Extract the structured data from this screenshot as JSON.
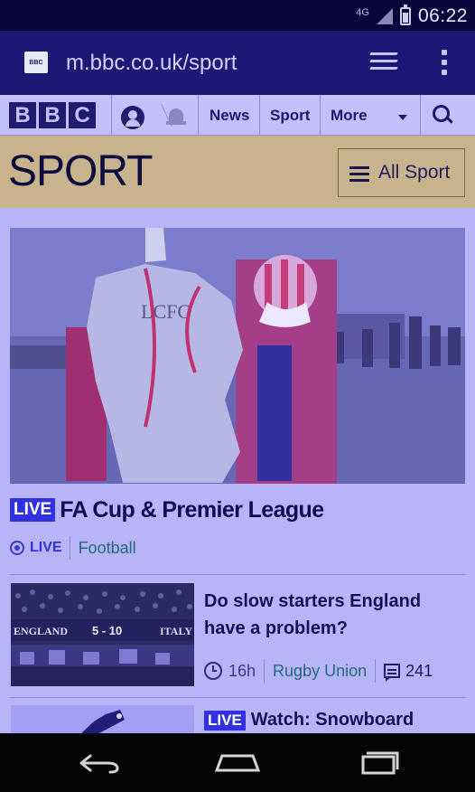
{
  "status_bar": {
    "network": "4G",
    "time": "06:22"
  },
  "browser": {
    "favicon_text": "BBC",
    "url": "m.bbc.co.uk/sport",
    "icons": [
      "tabs-icon",
      "overflow-menu-icon"
    ]
  },
  "bbc_nav": {
    "logo": [
      "B",
      "B",
      "C"
    ],
    "links": [
      "News",
      "Sport",
      "More"
    ],
    "icons": [
      "account-icon",
      "notifications-bell-icon",
      "chevron-down-icon",
      "search-icon"
    ]
  },
  "sport_header": {
    "title": "SPORT",
    "all_sport_label": "All Sport"
  },
  "hero": {
    "image_text": "LCFC",
    "live_badge": "LIVE",
    "headline": "FA Cup & Premier League",
    "live_label": "LIVE",
    "category": "Football"
  },
  "story1": {
    "title": "Do slow starters England have a problem?",
    "time_ago": "16h",
    "category": "Rugby Union",
    "comments": "241",
    "score_left": "ENGLAND",
    "score": "5 - 10",
    "score_right": "ITALY"
  },
  "story2": {
    "live_badge": "LIVE",
    "title": "Watch: Snowboard"
  },
  "android_nav": {
    "icons": [
      "back-icon",
      "home-icon",
      "recent-apps-icon"
    ]
  },
  "colors": {
    "tint": "#b9b4f8",
    "browser_bar": "#1c1876",
    "sport_header": "#c8b48c",
    "live_badge": "#3131e2"
  }
}
